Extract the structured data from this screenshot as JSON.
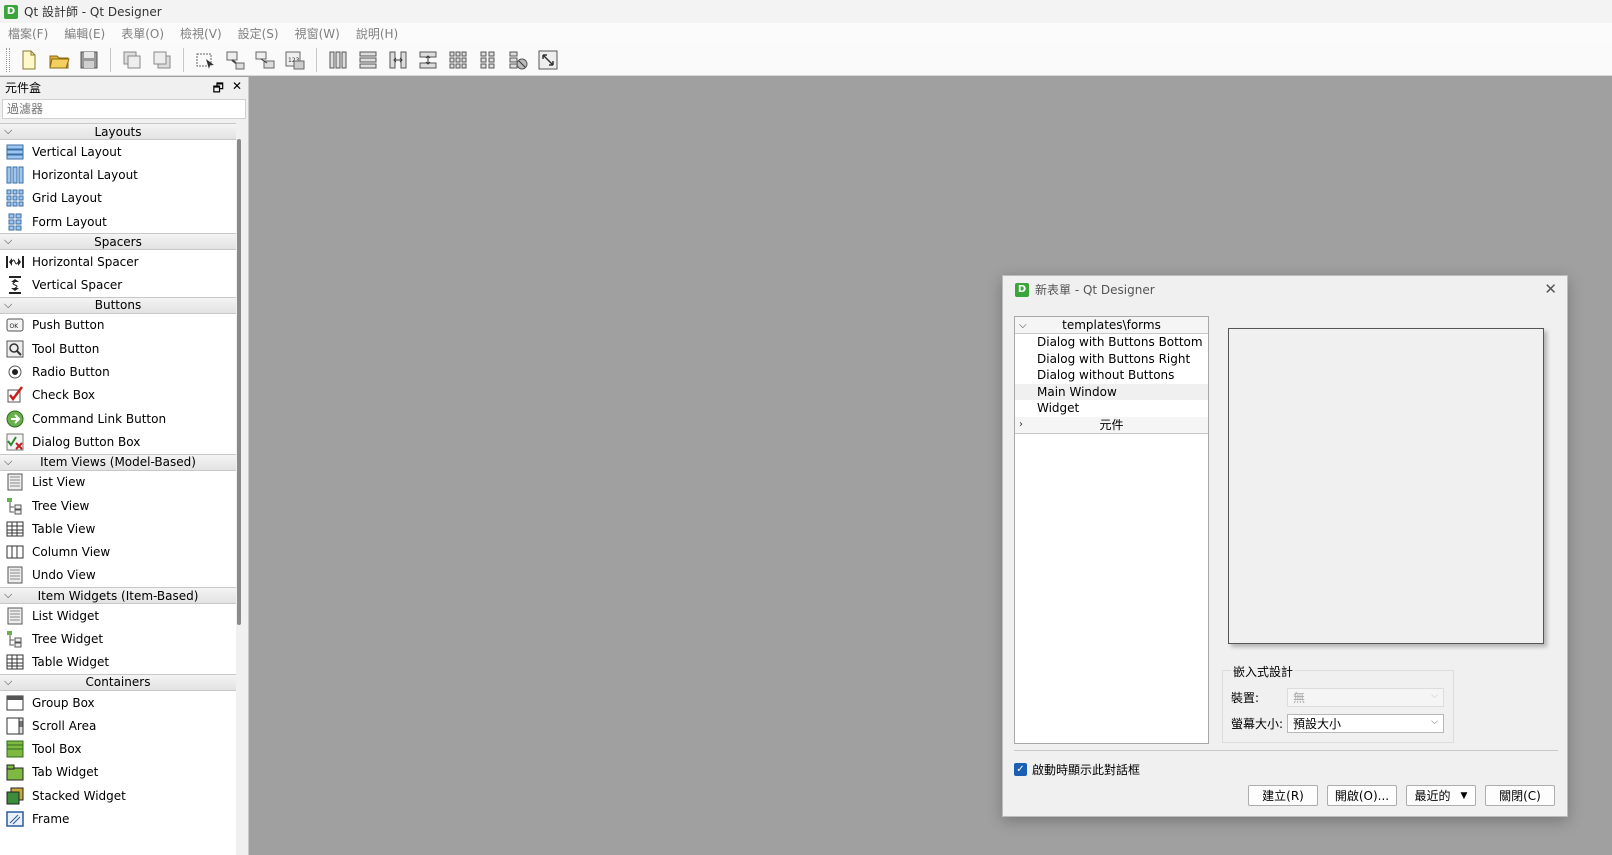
{
  "window": {
    "title": "Qt 設計師 - Qt Designer",
    "icon_letter": "D"
  },
  "menubar": {
    "items": [
      "檔案(F)",
      "編輯(E)",
      "表單(O)",
      "檢視(V)",
      "設定(S)",
      "視窗(W)",
      "說明(H)"
    ]
  },
  "toolbar": {
    "buttons": [
      "new-file-icon",
      "open-folder-icon",
      "save-icon",
      "send-to-back-icon",
      "bring-to-front-icon",
      "edit-widgets-icon",
      "edit-signals-slots-icon",
      "edit-buddies-icon",
      "edit-tab-order-icon",
      "layout-horizontal-icon",
      "layout-vertical-icon",
      "layout-h-splitter-icon",
      "layout-v-splitter-icon",
      "layout-grid-icon",
      "layout-form-icon",
      "break-layout-icon",
      "adjust-size-icon"
    ]
  },
  "widgetbox": {
    "title": "元件盒",
    "filter_placeholder": "過濾器",
    "categories": [
      {
        "label": "Layouts",
        "items": [
          "Vertical Layout",
          "Horizontal Layout",
          "Grid Layout",
          "Form Layout"
        ]
      },
      {
        "label": "Spacers",
        "items": [
          "Horizontal Spacer",
          "Vertical Spacer"
        ]
      },
      {
        "label": "Buttons",
        "items": [
          "Push Button",
          "Tool Button",
          "Radio Button",
          "Check Box",
          "Command Link Button",
          "Dialog Button Box"
        ]
      },
      {
        "label": "Item Views (Model-Based)",
        "items": [
          "List View",
          "Tree View",
          "Table View",
          "Column View",
          "Undo View"
        ]
      },
      {
        "label": "Item Widgets (Item-Based)",
        "items": [
          "List Widget",
          "Tree Widget",
          "Table Widget"
        ]
      },
      {
        "label": "Containers",
        "items": [
          "Group Box",
          "Scroll Area",
          "Tool Box",
          "Tab Widget",
          "Stacked Widget",
          "Frame"
        ]
      }
    ]
  },
  "new_form_dialog": {
    "title": "新表單 - Qt Designer",
    "templates_header": "templates\\forms",
    "templates": [
      "Dialog with Buttons Bottom",
      "Dialog with Buttons Right",
      "Dialog without Buttons",
      "Main Window",
      "Widget"
    ],
    "selected_template": "Main Window",
    "widgets_header": "元件",
    "embedded_group": "嵌入式設計",
    "device_label": "裝置:",
    "device_value": "無",
    "screen_size_label": "螢幕大小:",
    "screen_size_value": "預設大小",
    "show_on_startup": "啟動時顯示此對話框",
    "buttons": {
      "create": "建立(R)",
      "open": "開啟(O)...",
      "recent": "最近的",
      "close": "關閉(C)"
    }
  },
  "colors": {
    "workspace": "#a0a0a0",
    "accent": "#1a5fb4",
    "app_icon": "#3aa53a"
  }
}
